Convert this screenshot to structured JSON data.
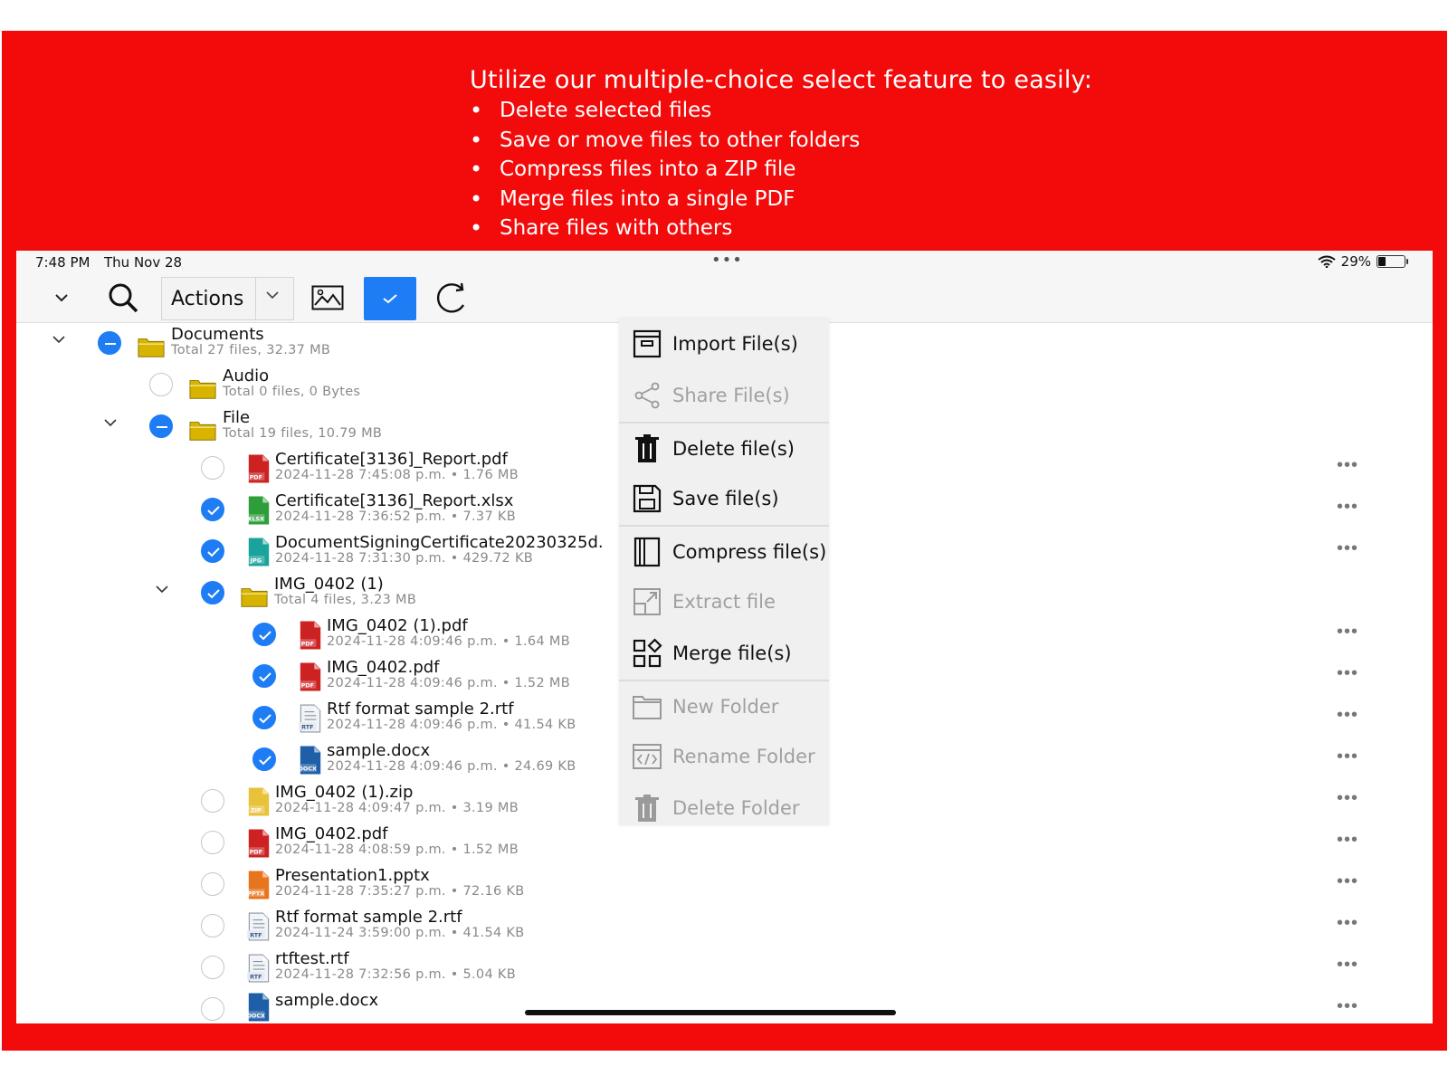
{
  "promo": {
    "heading": "Utilize our multiple-choice select feature to easily:",
    "bullets": [
      "Delete selected files",
      "Save or move files to other folders",
      "Compress files into a ZIP file",
      "Merge files into a single PDF",
      "Share files with others"
    ]
  },
  "status": {
    "time": "7:48 PM",
    "date": "Thu Nov 28",
    "battery": "29%",
    "multitask": "•••"
  },
  "toolbar": {
    "actions_label": "Actions"
  },
  "rows": [
    {
      "name": "Documents",
      "meta": "Total 27 files, 32.37 MB",
      "kind": "folder",
      "level": 0,
      "state": "partial",
      "expanded": true
    },
    {
      "name": "Audio",
      "meta": "Total 0 files, 0 Bytes",
      "kind": "folder",
      "level": 1,
      "state": "none"
    },
    {
      "name": "File",
      "meta": "Total 19 files, 10.79 MB",
      "kind": "folder",
      "level": 1,
      "state": "partial",
      "expanded": true
    },
    {
      "name": "Certificate[3136]_Report.pdf",
      "meta": "2024-11-28 7:45:08 p.m. • 1.76 MB",
      "kind": "PDF",
      "level": 2,
      "state": "none"
    },
    {
      "name": "Certificate[3136]_Report.xlsx",
      "meta": "2024-11-28 7:36:52 p.m. • 7.37 KB",
      "kind": "XLSX",
      "level": 2,
      "state": "checked"
    },
    {
      "name": "DocumentSigningCertificate20230325d.",
      "meta": "2024-11-28 7:31:30 p.m. • 429.72 KB",
      "kind": "JPG",
      "level": 2,
      "state": "checked"
    },
    {
      "name": "IMG_0402 (1)",
      "meta": "Total 4 files, 3.23 MB",
      "kind": "folder",
      "level": 2,
      "state": "checked",
      "expanded": true
    },
    {
      "name": "IMG_0402 (1).pdf",
      "meta": "2024-11-28 4:09:46 p.m. • 1.64 MB",
      "kind": "PDF",
      "level": 3,
      "state": "checked"
    },
    {
      "name": "IMG_0402.pdf",
      "meta": "2024-11-28 4:09:46 p.m. • 1.52 MB",
      "kind": "PDF",
      "level": 3,
      "state": "checked"
    },
    {
      "name": "Rtf format sample 2.rtf",
      "meta": "2024-11-28 4:09:46 p.m. • 41.54 KB",
      "kind": "RTF",
      "level": 3,
      "state": "checked"
    },
    {
      "name": "sample.docx",
      "meta": "2024-11-28 4:09:46 p.m. • 24.69 KB",
      "kind": "DOCX",
      "level": 3,
      "state": "checked"
    },
    {
      "name": "IMG_0402 (1).zip",
      "meta": "2024-11-28 4:09:47 p.m. • 3.19 MB",
      "kind": "ZIP",
      "level": 2,
      "state": "none"
    },
    {
      "name": "IMG_0402.pdf",
      "meta": "2024-11-28 4:08:59 p.m. • 1.52 MB",
      "kind": "PDF",
      "level": 2,
      "state": "none"
    },
    {
      "name": "Presentation1.pptx",
      "meta": "2024-11-28 7:35:27 p.m. • 72.16 KB",
      "kind": "PPTX",
      "level": 2,
      "state": "none"
    },
    {
      "name": "Rtf format sample 2.rtf",
      "meta": "2024-11-24 3:59:00 p.m. • 41.54 KB",
      "kind": "RTF",
      "level": 2,
      "state": "none"
    },
    {
      "name": "rtftest.rtf",
      "meta": "2024-11-28 7:32:56 p.m. • 5.04 KB",
      "kind": "RTF",
      "level": 2,
      "state": "none"
    },
    {
      "name": "sample.docx",
      "meta": "",
      "kind": "DOCX",
      "level": 2,
      "state": "none"
    }
  ],
  "menu": [
    {
      "label": "Import File(s)",
      "icon": "import-icon",
      "enabled": true
    },
    {
      "label": "Share File(s)",
      "icon": "share-icon",
      "enabled": false
    },
    {
      "label": "Delete file(s)",
      "icon": "trash-icon",
      "enabled": true
    },
    {
      "label": "Save file(s)",
      "icon": "save-icon",
      "enabled": true
    },
    {
      "label": "Compress file(s)",
      "icon": "compress-icon",
      "enabled": true
    },
    {
      "label": "Extract file",
      "icon": "extract-icon",
      "enabled": false
    },
    {
      "label": "Merge file(s)",
      "icon": "merge-icon",
      "enabled": true
    },
    {
      "label": "New Folder",
      "icon": "new-folder-icon",
      "enabled": false
    },
    {
      "label": "Rename Folder",
      "icon": "rename-folder-icon",
      "enabled": false
    },
    {
      "label": "Delete Folder",
      "icon": "delete-folder-icon",
      "enabled": false
    }
  ],
  "colors": {
    "frame": "#f30b0b",
    "accent": "#1e7df5",
    "folder": "#d8b400",
    "pdf": "#cc2222",
    "xlsx": "#2e9e3a",
    "jpg": "#1aa39a",
    "zip": "#e8c23a",
    "pptx": "#e8741e",
    "docx": "#1f5fa8",
    "rtf": "#7a8aa0"
  }
}
